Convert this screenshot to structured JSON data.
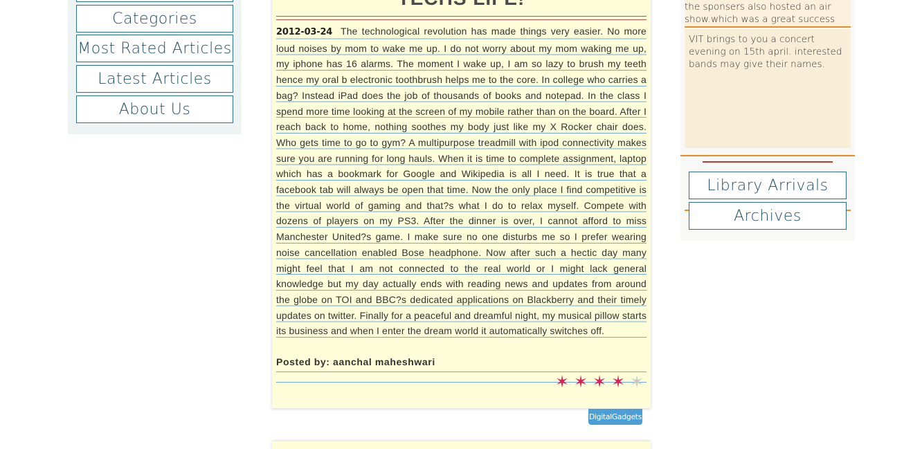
{
  "left_nav": {
    "items": [
      {
        "label": ""
      },
      {
        "label": "Categories"
      },
      {
        "label": "Most Rated Articles"
      },
      {
        "label": "Latest Articles"
      },
      {
        "label": "About Us"
      }
    ]
  },
  "article": {
    "title": "TECHS LIFE!",
    "date": "2012-03-24",
    "body": "The technological revolution has made things very easier. No more loud noises by mom to wake me up. I do not worry about my mom waking me up, my iphone has 16 alarms. The moment I wake up, I am so lazy to brush my teeth hence my oral b electronic toothbrush helps me to the core. In college who carries a bag? Instead iPad does the job of thousands of books and notepad. In the class I spend more time looking at the screen of my mobile rather than on the board. After I reach back to home, nothing soothes my body just like my X Rocker chair does. Who gets time to go to gym? A multipurpose treadmill with ipod connectivity makes sure you are running for long hauls. When it is time to complete assignment, laptop which has a bookmark for Google and Wikipedia is all I need. It is true that a facebook tab will always be open that time. Now the only place I find competitive is the virtual world of gaming and that?s what I do to relax myself. Compete with dozens of players on my PS3. After the dinner is over, I cannot afford to miss Manchester United?s game. I make sure no one disturbs me so I prefer wearing noise cancellation enabled Bose headphone. Now after such a hectic day many might feel that I am not connected to the real world or I might lack general knowledge but my day actually ends with reading news and updates from around the globe on TOI and BBC?s dedicated applications on Blackberry and their timely updates on twitter. Finally for a peaceful and dreamful night, my musical pillow starts its business and when I enter the dream world it automatically switches off.",
    "posted_by": "Posted by: aanchal maheshwari",
    "rating": 4,
    "rating_max": 5,
    "tag": "DigitalGadgets",
    "star_on_color": "#d6245a",
    "star_off_color": "#c8c8c8"
  },
  "news": {
    "previous": "the sponsers also hosted an air show.which was a great success",
    "current": "VIT brings to you a concert evening on 15th april. interested bands may give their names."
  },
  "right_nav": {
    "items": [
      {
        "label": "Library Arrivals"
      },
      {
        "label": "Archives"
      }
    ]
  }
}
